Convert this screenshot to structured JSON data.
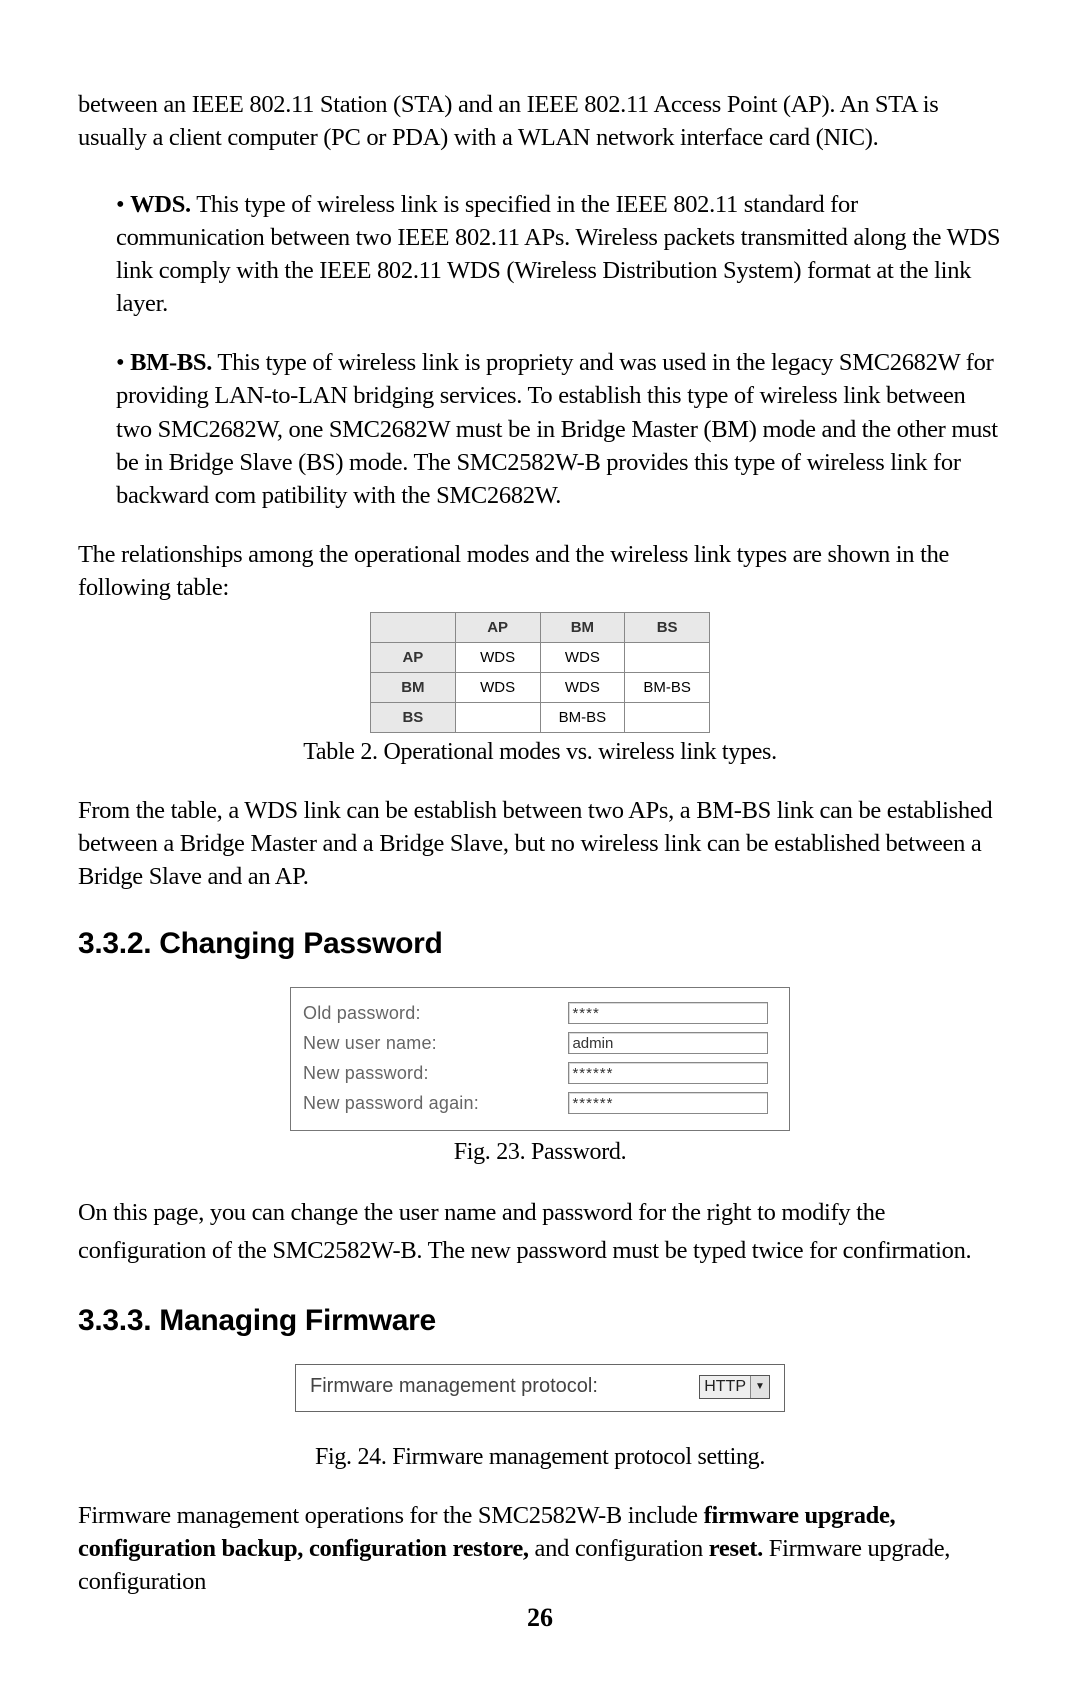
{
  "intro": "between an IEEE 802.11 Station (STA) and an IEEE 802.11 Access Point (AP). An STA is usually a client computer (PC or PDA) with a WLAN network interface card (NIC).",
  "bullets": {
    "wds": {
      "label": "WDS.",
      "text": " This type of wireless link is specified in the IEEE 802.11 standard for communication between two IEEE 802.11 APs. Wireless packets transmitted along the WDS link comply with the IEEE 802.11 WDS (Wireless Distribution System) format at the link layer."
    },
    "bmbs": {
      "label": "BM-BS.",
      "text": " This type of wireless link is propriety and was used in the legacy SMC2682W for providing LAN-to-LAN bridging services. To establish this type of wireless link between two SMC2682W, one SMC2682W must be in Bridge Master (BM) mode and the other must be in Bridge Slave (BS) mode. The SMC2582W-B provides this type of wireless link for backward com patibility with the SMC2682W."
    }
  },
  "table_lead": "The relationships among the operational modes and the wireless link types are shown in the following table:",
  "modes_table": {
    "cols": [
      "",
      "AP",
      "BM",
      "BS"
    ],
    "rows": [
      [
        "AP",
        "WDS",
        "WDS",
        ""
      ],
      [
        "BM",
        "WDS",
        "WDS",
        "BM-BS"
      ],
      [
        "BS",
        "",
        "BM-BS",
        ""
      ]
    ],
    "caption": "Table 2. Operational modes vs. wireless link types."
  },
  "table_follow": "From the table, a WDS link can be establish between two APs, a BM-BS link can be established between a Bridge Master and a Bridge Slave, but no wireless link can be established between a Bridge Slave and an AP.",
  "sections": {
    "pw_heading": "3.3.2. Changing Password",
    "fw_heading": "3.3.3. Managing Firmware"
  },
  "password_form": {
    "fields": [
      {
        "label": "Old password:",
        "value": "****",
        "type": "password"
      },
      {
        "label": "New user name:",
        "value": "admin",
        "type": "text"
      },
      {
        "label": "New password:",
        "value": "******",
        "type": "password"
      },
      {
        "label": "New password again:",
        "value": "******",
        "type": "password"
      }
    ],
    "caption": "Fig. 23. Password."
  },
  "password_text": "On this page, you can change the user name and password for the right to modify the configuration of the SMC2582W-B. The new password must be typed twice for confirmation.",
  "firmware_form": {
    "label": "Firmware management protocol:",
    "value": "HTTP",
    "caption": "Fig. 24. Firmware management protocol setting."
  },
  "firmware_text": {
    "pre": "Firmware management operations for the SMC2582W-B include ",
    "b1": "firmware upgrade, configuration backup, configuration restore,",
    "mid": " and configuration ",
    "b2": "reset.",
    "post": " Firmware upgrade, configuration"
  },
  "page_number": "26"
}
